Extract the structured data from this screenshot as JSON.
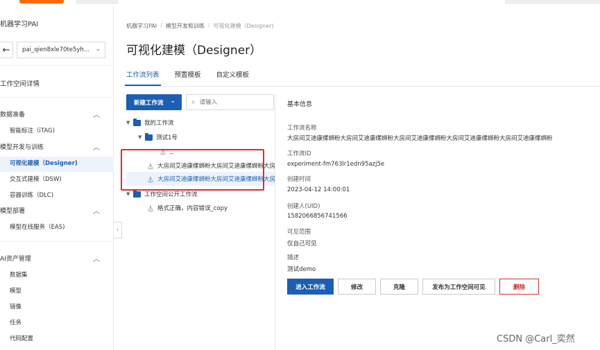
{
  "sidebar": {
    "title": "机器学习PAI",
    "workspace": "pai_qien8xle70te5yh...",
    "workspace_detail": "工作空间详情",
    "groups": [
      {
        "label": "数据准备",
        "items": [
          "智能标注（iTAG)"
        ]
      },
      {
        "label": "模型开发与训练",
        "items": [
          "可视化建模（Designer)",
          "交互式建模（DSW)",
          "容器训练（DLC)"
        ]
      },
      {
        "label": "模型部署",
        "items": [
          "模型在线服务（EAS)"
        ]
      },
      {
        "label": "AI资产管理",
        "items": [
          "数据集",
          "模型",
          "镜像",
          "任务",
          "代码配置"
        ]
      }
    ]
  },
  "breadcrumb": [
    "机器学习PAI",
    "模型开发和训练",
    "可视化建模（Designer)"
  ],
  "page_title": "可视化建模（Designer）",
  "tabs": [
    "工作流列表",
    "预置模板",
    "自定义模板"
  ],
  "toolbar": {
    "new_label": "新建工作流",
    "search_placeholder": "请输入"
  },
  "tree": {
    "my_workflows": "我的工作流",
    "folder_test": "测试1号",
    "item_underscore": "_",
    "item_long_1": "大房间艾迪康缧蛳粉大房间艾迪康缧蛳粉大房间艾迪康缧蛳粉大房间",
    "item_long_2": "大房间艾迪康缧蛳粉大房间艾迪康缧蛳粉大房间艾迪康缧蛳粉大房间",
    "public_workflows": "工作空间公开工作流",
    "item_public": "格式正确，内容错误_copy"
  },
  "details": {
    "section_title": "基本信息",
    "name_label": "工作流名称",
    "name_value": "大房间艾迪康缧蛳粉大房间艾迪康缧蛳粉大房间艾迪康缧蛳粉大房间艾迪康缧蛳粉大房间艾迪康缧蛳粉",
    "id_label": "工作流ID",
    "id_value": "experiment-fm763lr1edn95azj5e",
    "created_label": "创建时间",
    "created_value": "2023-04-12 14:00:01",
    "creator_label": "创建人(UID)",
    "creator_value": "1582066856741566",
    "visibility_label": "可见范围",
    "visibility_value": "仅自己可见",
    "desc_label": "描述",
    "desc_value": "测试demo"
  },
  "actions": {
    "enter": "进入工作流",
    "edit": "修改",
    "clone": "克隆",
    "publish": "发布为工作空间可见",
    "delete": "删除"
  },
  "watermark": "CSDN @Carl_奕然"
}
